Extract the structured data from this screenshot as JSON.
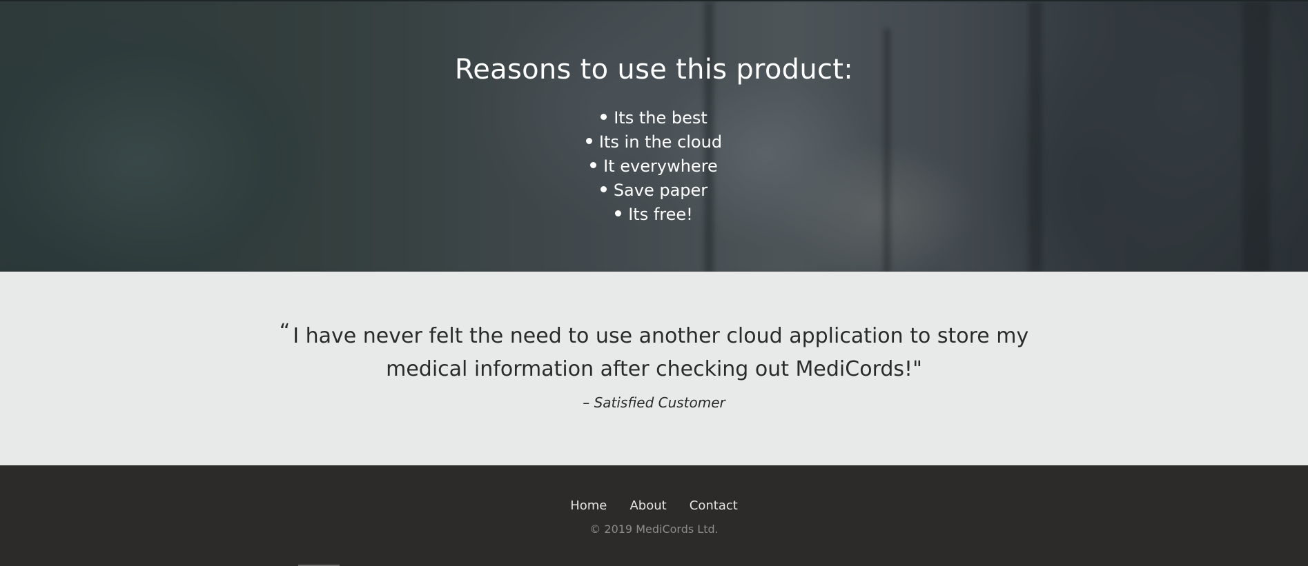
{
  "hero": {
    "title": "Reasons to use this product:",
    "reasons": [
      "Its the best",
      "Its in the cloud",
      "It everywhere",
      "Save paper",
      "Its free!"
    ]
  },
  "testimonial": {
    "open_quote": "“",
    "quote": "I have never felt the need to use another cloud application to store my medical information after checking out MediCords!\"",
    "author": "– Satisfied Customer"
  },
  "footer": {
    "nav": [
      "Home",
      "About",
      "Contact"
    ],
    "copyright": "© 2019 MediCords Ltd."
  },
  "colors": {
    "testimonial_bg": "#e8e9e9",
    "footer_bg": "#2d2b29"
  }
}
